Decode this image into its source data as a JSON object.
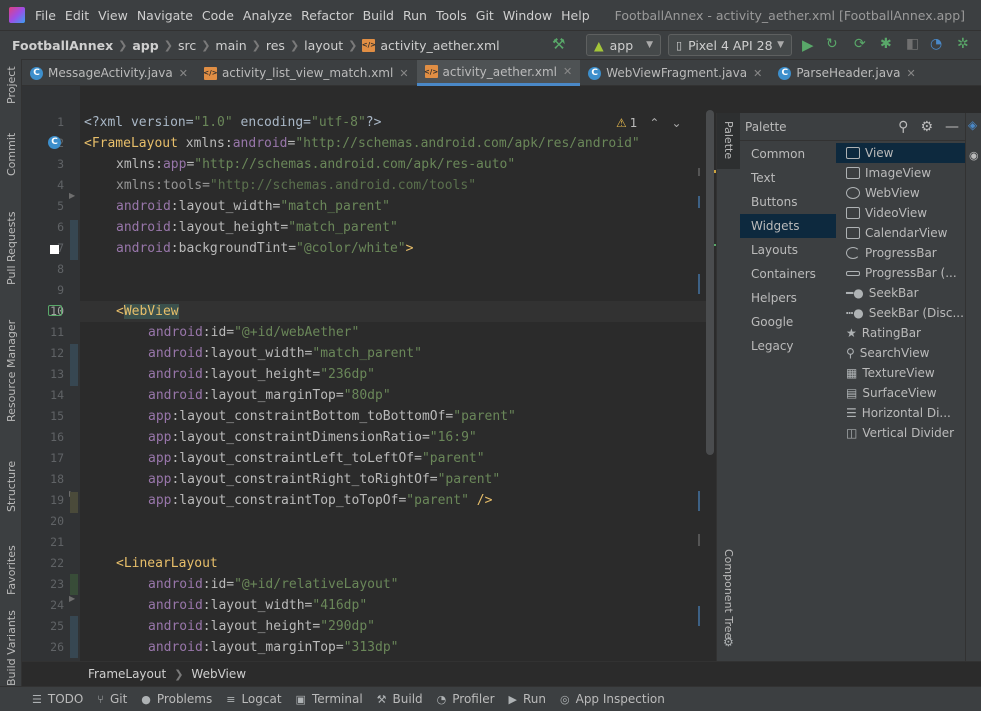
{
  "menu": [
    "File",
    "Edit",
    "View",
    "Navigate",
    "Code",
    "Analyze",
    "Refactor",
    "Build",
    "Run",
    "Tools",
    "Git",
    "Window",
    "Help"
  ],
  "window_title": "FootballAnnex - activity_aether.xml [FootballAnnex.app]",
  "nav": {
    "breadcrumbs": [
      "FootballAnnex",
      "app",
      "src",
      "main",
      "res",
      "layout",
      "activity_aether.xml"
    ],
    "run_config": "app",
    "device": "Pixel 4 API 28"
  },
  "tabs": [
    {
      "label": "MessageActivity.java",
      "type": "java"
    },
    {
      "label": "activity_list_view_match.xml",
      "type": "xml"
    },
    {
      "label": "activity_aether.xml",
      "type": "xml",
      "active": true
    },
    {
      "label": "WebViewFragment.java",
      "type": "java"
    },
    {
      "label": "ParseHeader.java",
      "type": "java"
    }
  ],
  "left_tools": [
    "Project",
    "Commit",
    "Pull Requests",
    "Resource Manager",
    "Structure",
    "Favorites",
    "Build Variants"
  ],
  "right_tools": [
    "Palette",
    "Component Tree"
  ],
  "inspection": {
    "warning_count": "1"
  },
  "line_numbers": [
    "1",
    "2",
    "3",
    "4",
    "5",
    "6",
    "7",
    "8",
    "9",
    "10",
    "11",
    "12",
    "13",
    "14",
    "15",
    "16",
    "17",
    "18",
    "19",
    "20",
    "21",
    "22",
    "23",
    "24",
    "25",
    "26"
  ],
  "code": {
    "l1": {
      "a": "<?xml version=",
      "b": "\"1.0\"",
      "c": " encoding=",
      "d": "\"utf-8\"",
      "e": "?>"
    },
    "l2": {
      "a": "<FrameLayout ",
      "b": "xmlns:",
      "c": "android",
      "d": "=",
      "e": "\"http://schemas.android.com/apk/res/android\""
    },
    "l3": {
      "a": "xmlns:",
      "b": "app",
      "c": "=",
      "d": "\"http://schemas.android.com/apk/res-auto\""
    },
    "l4": {
      "a": "xmlns:tools=",
      "b": "\"http://schemas.android.com/tools\""
    },
    "l5": {
      "a": "android",
      "b": ":layout_width=",
      "c": "\"match_parent\""
    },
    "l6": {
      "a": "android",
      "b": ":layout_height=",
      "c": "\"match_parent\""
    },
    "l7": {
      "a": "android",
      "b": ":backgroundTint=",
      "c": "\"@color/white\"",
      "d": ">"
    },
    "l10": {
      "a": "<",
      "b": "WebView"
    },
    "l11": {
      "a": "android",
      "b": ":id=",
      "c": "\"@+id/webAether\""
    },
    "l12": {
      "a": "android",
      "b": ":layout_width=",
      "c": "\"match_parent\""
    },
    "l13": {
      "a": "android",
      "b": ":layout_height=",
      "c": "\"236dp\""
    },
    "l14": {
      "a": "android",
      "b": ":layout_marginTop=",
      "c": "\"80dp\""
    },
    "l15": {
      "a": "app",
      "b": ":layout_constraintBottom_toBottomOf=",
      "c": "\"parent\""
    },
    "l16": {
      "a": "app",
      "b": ":layout_constraintDimensionRatio=",
      "c": "\"16:9\""
    },
    "l17": {
      "a": "app",
      "b": ":layout_constraintLeft_toLeftOf=",
      "c": "\"parent\""
    },
    "l18": {
      "a": "app",
      "b": ":layout_constraintRight_toRightOf=",
      "c": "\"parent\""
    },
    "l19": {
      "a": "app",
      "b": ":layout_constraintTop_toTopOf=",
      "c": "\"parent\"",
      "d": " />"
    },
    "l22": {
      "a": "<LinearLayout"
    },
    "l23": {
      "a": "android",
      "b": ":id=",
      "c": "\"@+id/relativeLayout\""
    },
    "l24": {
      "a": "android",
      "b": ":layout_width=",
      "c": "\"416dp\""
    },
    "l25": {
      "a": "android",
      "b": ":layout_height=",
      "c": "\"290dp\""
    },
    "l26": {
      "a": "android",
      "b": ":layout_marginTop=",
      "c": "\"313dp\""
    }
  },
  "palette": {
    "title": "Palette",
    "categories": [
      "Common",
      "Text",
      "Buttons",
      "Widgets",
      "Layouts",
      "Containers",
      "Helpers",
      "Google",
      "Legacy"
    ],
    "selected_category": "Widgets",
    "widgets": [
      "View",
      "ImageView",
      "WebView",
      "VideoView",
      "CalendarView",
      "ProgressBar",
      "ProgressBar (...",
      "SeekBar",
      "SeekBar (Disc...",
      "RatingBar",
      "SearchView",
      "TextureView",
      "SurfaceView",
      "Horizontal Di...",
      "Vertical Divider"
    ],
    "selected_widget": "View"
  },
  "editor_breadcrumb": [
    "FrameLayout",
    "WebView"
  ],
  "status_tools": [
    "TODO",
    "Git",
    "Problems",
    "Logcat",
    "Terminal",
    "Build",
    "Profiler",
    "Run",
    "App Inspection"
  ],
  "colors": {
    "accent": "#4a88c7",
    "run": "#59a869",
    "selection": "#0d293e"
  }
}
